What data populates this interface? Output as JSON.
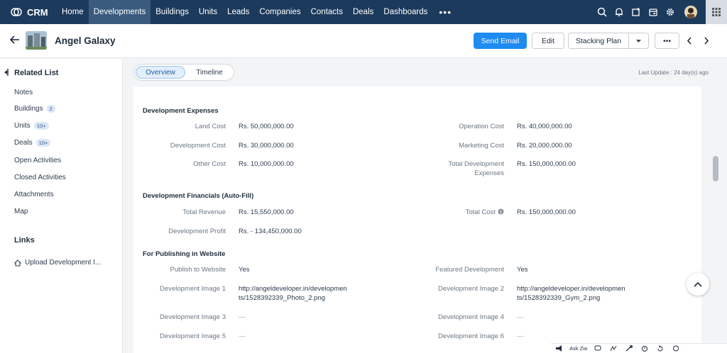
{
  "nav": {
    "brand": "CRM",
    "items": [
      "Home",
      "Developments",
      "Buildings",
      "Units",
      "Leads",
      "Companies",
      "Contacts",
      "Deals",
      "Dashboards"
    ],
    "more": "•••"
  },
  "header": {
    "title": "Angel Galaxy",
    "send_email": "Send Email",
    "edit": "Edit",
    "stacking_plan": "Stacking Plan",
    "more": "•••"
  },
  "sidebar": {
    "related_title": "Related List",
    "items": [
      {
        "label": "Notes",
        "badge": ""
      },
      {
        "label": "Buildings",
        "badge": "2"
      },
      {
        "label": "Units",
        "badge": "10+"
      },
      {
        "label": "Deals",
        "badge": "10+"
      },
      {
        "label": "Open Activities",
        "badge": ""
      },
      {
        "label": "Closed Activities",
        "badge": ""
      },
      {
        "label": "Attachments",
        "badge": ""
      },
      {
        "label": "Map",
        "badge": ""
      }
    ],
    "links_title": "Links",
    "link_item": "Upload Development I..."
  },
  "tabs": {
    "overview": "Overview",
    "timeline": "Timeline",
    "last_update": "Last Update : 24 day(s) ago"
  },
  "sections": {
    "expenses": {
      "title": "Development Expenses",
      "land_cost_label": "Land Cost",
      "land_cost": "Rs. 50,000,000.00",
      "operation_cost_label": "Operation Cost",
      "operation_cost": "Rs. 40,000,000.00",
      "development_cost_label": "Development Cost",
      "development_cost": "Rs. 30,000,000.00",
      "marketing_cost_label": "Marketing Cost",
      "marketing_cost": "Rs. 20,000,000.00",
      "other_cost_label": "Other Cost",
      "other_cost": "Rs. 10,000,000.00",
      "total_dev_label_1": "Total Development",
      "total_dev_label_2": "Expenses",
      "total_dev": "Rs. 150,000,000.00"
    },
    "financials": {
      "title": "Development Financials (Auto-Fill)",
      "total_revenue_label": "Total Revenue",
      "total_revenue": "Rs. 15,550,000.00",
      "total_cost_label": "Total Cost",
      "total_cost": "Rs. 150,000,000.00",
      "profit_label": "Development Profit",
      "profit": "Rs. - 134,450,000.00"
    },
    "publishing": {
      "title": "For Publishing in Website",
      "publish_label": "Publish to Website",
      "publish": "Yes",
      "featured_label": "Featured Development",
      "featured": "Yes",
      "img1_label": "Development Image 1",
      "img1_l1": "http://angeldeveloper.in/developmen",
      "img1_l2": "ts/1528392339_Photo_2.png",
      "img2_label": "Development Image 2",
      "img2_l1": "http://angeldeveloper.in/developmen",
      "img2_l2": "ts/1528392339_Gym_2.png",
      "img3_label": "Development Image 3",
      "img3": "—",
      "img4_label": "Development Image 4",
      "img4": "—",
      "img5_label": "Development Image 5",
      "img5": "—",
      "img6_label": "Development Image 6",
      "img6": "—"
    }
  },
  "bottombar": {
    "ask_zia": "Ask Zia"
  },
  "colors": {
    "nav_bg": "#1c3a5c",
    "nav_active": "#3a5a7e",
    "primary": "#1f8bf0"
  }
}
